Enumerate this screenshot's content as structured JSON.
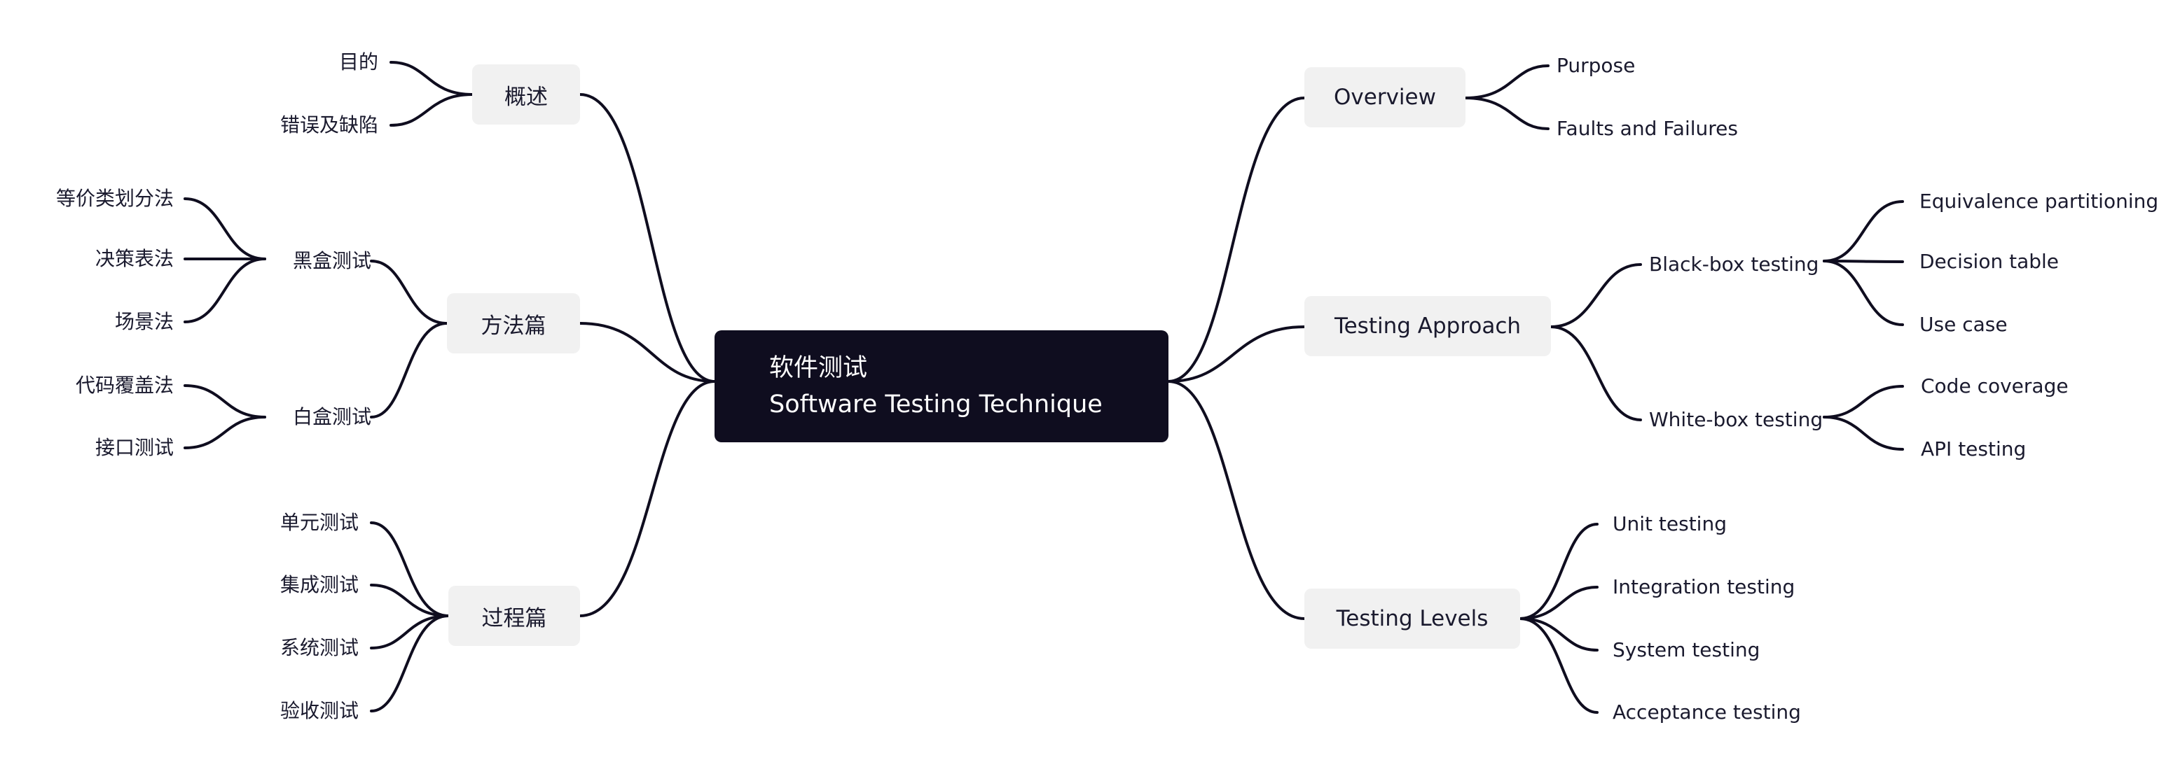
{
  "root": {
    "line1": "软件测试",
    "line2": "Software Testing Technique"
  },
  "left": {
    "overview": {
      "label": "概述",
      "items": [
        "目的",
        "错误及缺陷"
      ]
    },
    "methods": {
      "label": "方法篇",
      "blackbox": {
        "label": "黑盒测试",
        "items": [
          "等价类划分法",
          "决策表法",
          "场景法"
        ]
      },
      "whitebox": {
        "label": "白盒测试",
        "items": [
          "代码覆盖法",
          "接口测试"
        ]
      }
    },
    "process": {
      "label": "过程篇",
      "items": [
        "单元测试",
        "集成测试",
        "系统测试",
        "验收测试"
      ]
    }
  },
  "right": {
    "overview": {
      "label": "Overview",
      "items": [
        "Purpose",
        "Faults and Failures"
      ]
    },
    "approach": {
      "label": "Testing Approach",
      "blackbox": {
        "label": "Black-box testing",
        "items": [
          "Equivalence partitioning",
          "Decision table",
          "Use case"
        ]
      },
      "whitebox": {
        "label": "White-box testing",
        "items": [
          "Code coverage",
          "API testing"
        ]
      }
    },
    "levels": {
      "label": "Testing Levels",
      "items": [
        "Unit testing",
        "Integration testing",
        "System testing",
        "Acceptance testing"
      ]
    }
  },
  "colors": {
    "root_fill": "#0f0d1f",
    "topic_fill": "#f1f1f1",
    "line": "#0f0d1f",
    "text": "#1a1a2e"
  }
}
